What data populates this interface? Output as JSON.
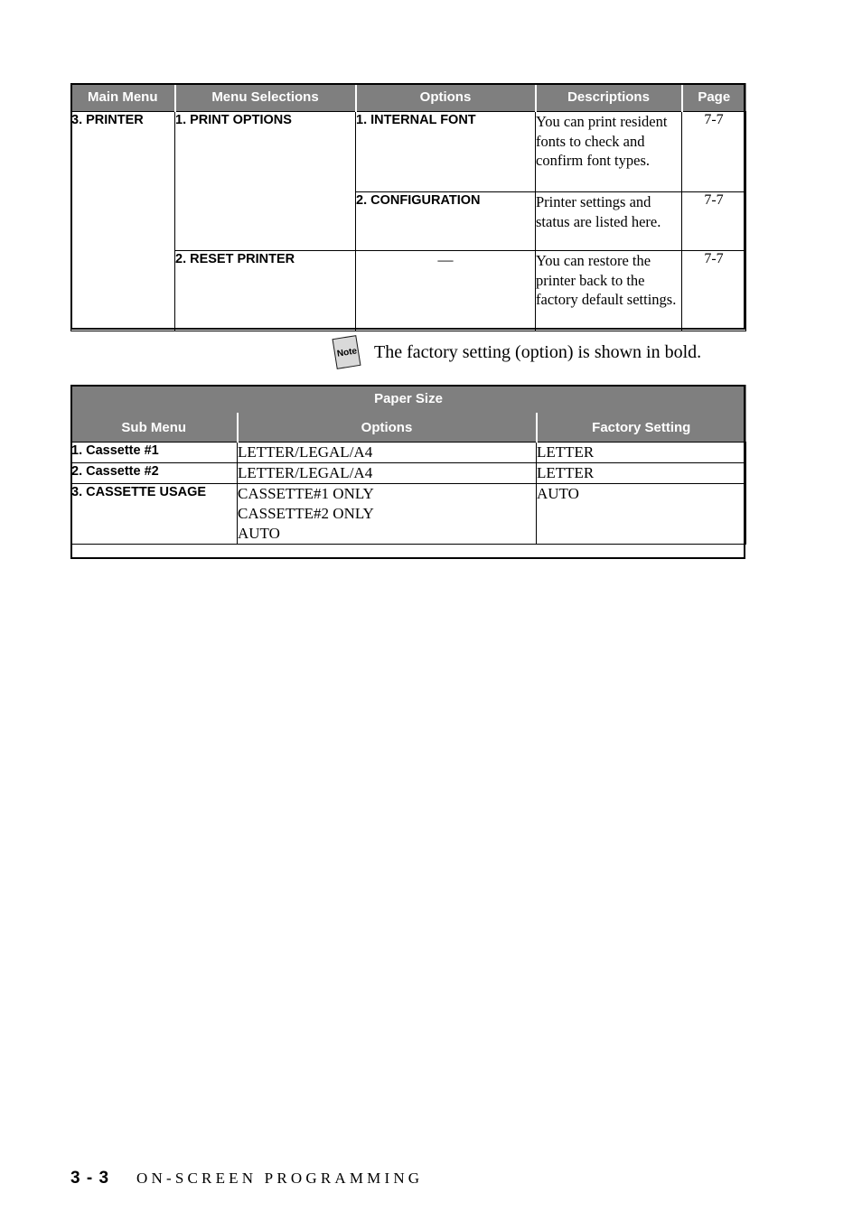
{
  "menu_table": {
    "headers": [
      "Main Menu",
      "Menu Selections",
      "Options",
      "Descriptions",
      "Page"
    ],
    "rows": [
      {
        "main_menu": "3. PRINTER",
        "menu_selection": "1. PRINT OPTIONS",
        "option": "1. INTERNAL FONT",
        "description": "You can print resident fonts to check and confirm font types.",
        "page": "7-7"
      },
      {
        "main_menu": "",
        "menu_selection": "",
        "option": "2. CONFIGURATION",
        "description": "Printer settings and status are listed here.",
        "page": "7-7"
      },
      {
        "main_menu": "",
        "menu_selection": "2. RESET PRINTER",
        "option": "—",
        "description": "You can restore the printer back to the factory default settings.",
        "page": "7-7"
      }
    ]
  },
  "note": {
    "icon_label": "Note",
    "text": "The factory setting (option) is shown in bold."
  },
  "paper_table": {
    "title": "Paper Size",
    "headers": [
      "Sub Menu",
      "Options",
      "Factory Setting"
    ],
    "rows": [
      {
        "sub_menu": "1. Cassette #1",
        "options": "LETTER/LEGAL/A4",
        "factory_setting": "LETTER"
      },
      {
        "sub_menu": "2. Cassette #2",
        "options": "LETTER/LEGAL/A4",
        "factory_setting": "LETTER"
      },
      {
        "sub_menu": "3. CASSETTE USAGE",
        "options": "CASSETTE#1 ONLY\nCASSETTE#2 ONLY\nAUTO",
        "factory_setting": "AUTO"
      }
    ]
  },
  "footer": {
    "page_number": "3 - 3",
    "chapter_title": "ON-SCREEN PROGRAMMING"
  },
  "colors": {
    "header_gray": "#7f7f7f",
    "header_text": "#ffffff",
    "border": "#000000",
    "note_icon_fill": "#d9d9d9"
  }
}
